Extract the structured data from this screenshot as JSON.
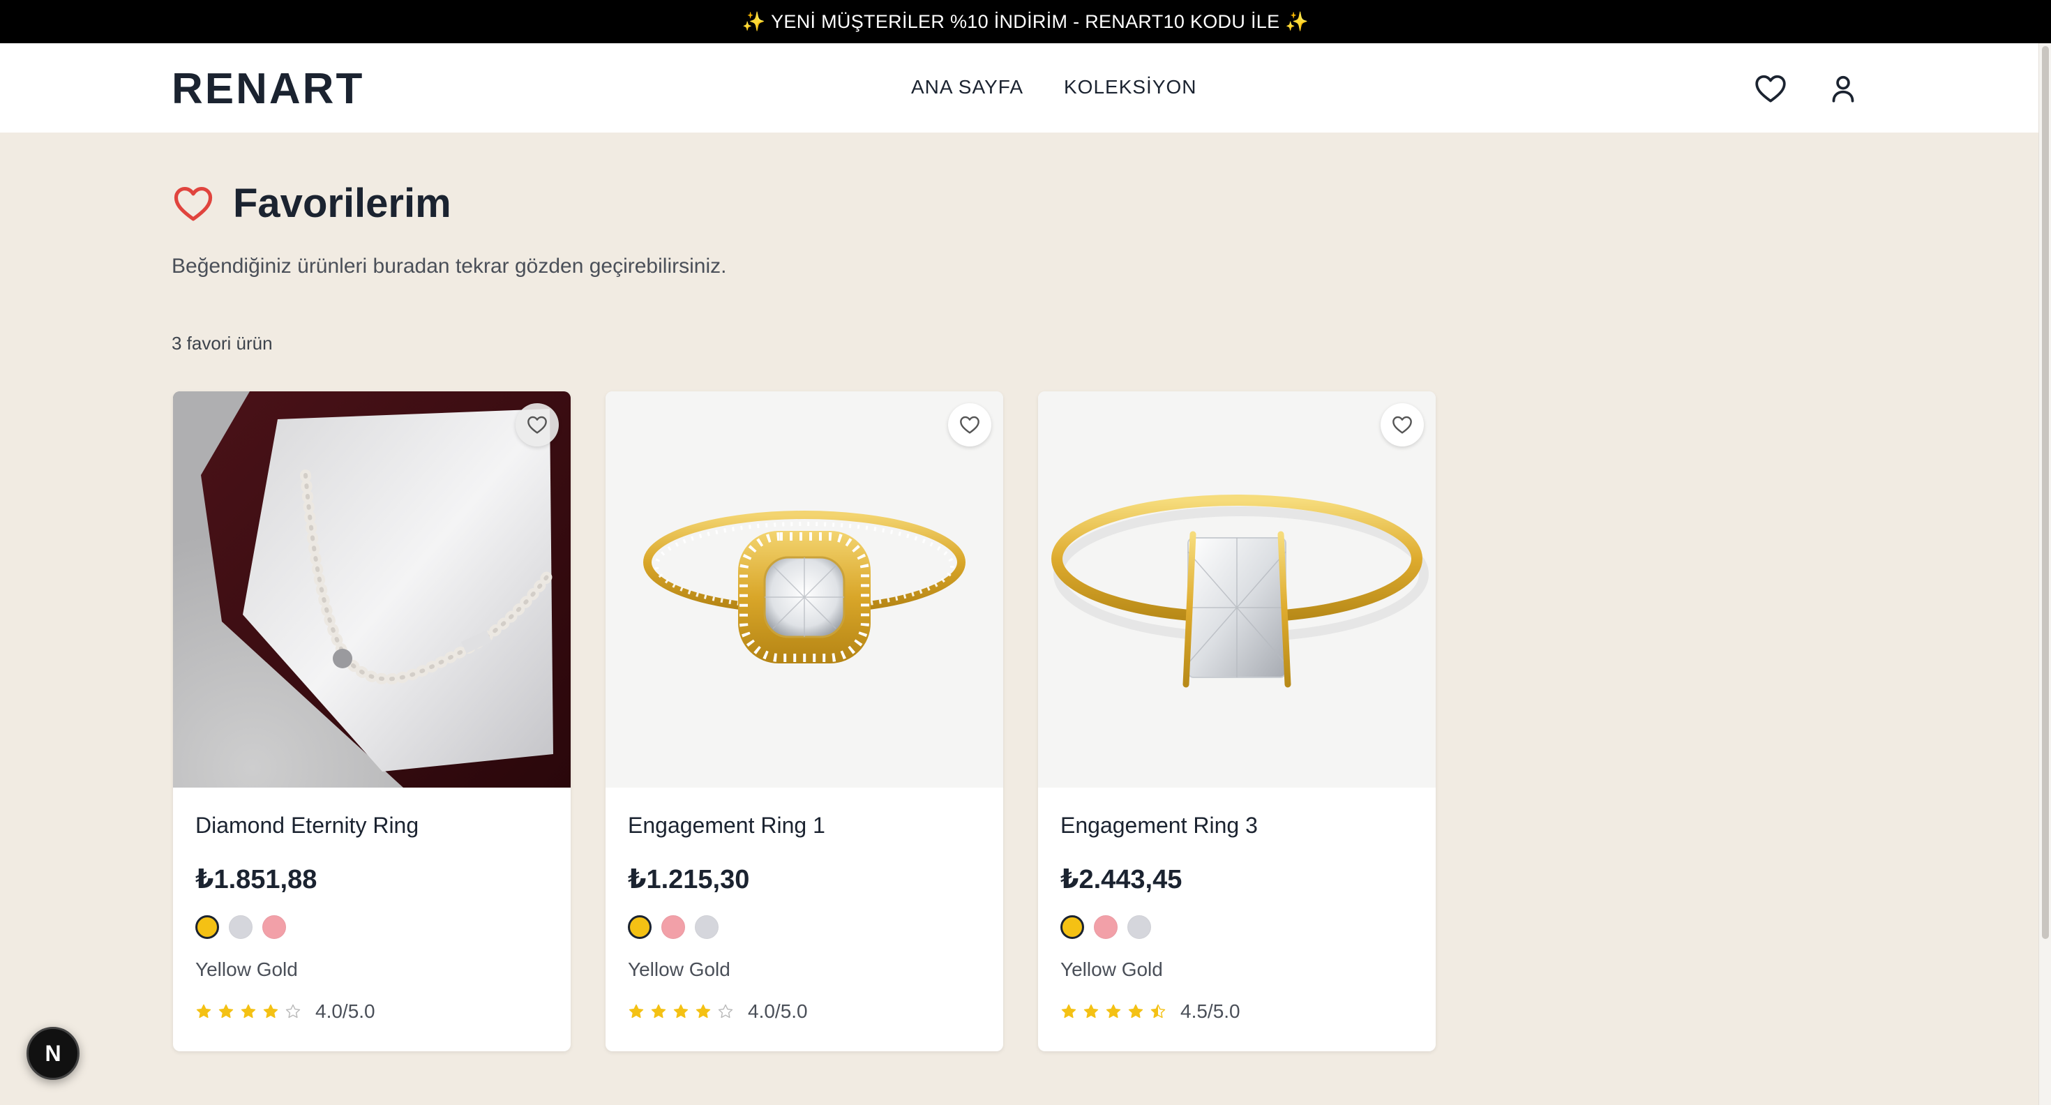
{
  "announcement": "✨ YENİ MÜŞTERİLER %10 İNDİRİM - RENART10 KODU İLE ✨",
  "header": {
    "logo": "RENART",
    "nav": [
      "ANA SAYFA",
      "KOLEKSİYON"
    ],
    "icons": [
      "heart-icon",
      "user-icon"
    ]
  },
  "page": {
    "title": "Favorilerim",
    "subtitle": "Beğendiğiniz ürünleri buradan tekrar gözden geçirebilirsiniz.",
    "count": "3 favori ürün"
  },
  "products": [
    {
      "name": "Diamond Eternity Ring",
      "price": "₺1.851,88",
      "swatches": [
        "yellow",
        "silver",
        "rose"
      ],
      "selected_color": "Yellow Gold",
      "rating": 4.0,
      "rating_text": "4.0/5.0"
    },
    {
      "name": "Engagement Ring 1",
      "price": "₺1.215,30",
      "swatches": [
        "yellow",
        "rose",
        "silver"
      ],
      "selected_color": "Yellow Gold",
      "rating": 4.0,
      "rating_text": "4.0/5.0"
    },
    {
      "name": "Engagement Ring 3",
      "price": "₺2.443,45",
      "swatches": [
        "yellow",
        "rose",
        "silver"
      ],
      "selected_color": "Yellow Gold",
      "rating": 4.5,
      "rating_text": "4.5/5.0"
    }
  ],
  "colors": {
    "announcement_bg": "#000000",
    "page_bg": "#f1ebe2",
    "accent_heart": "#e0443e",
    "star": "#f4c114",
    "gold": "#f4c114",
    "silver": "#d5d6dc",
    "rose": "#f2a0a8"
  },
  "dev_badge": "N"
}
